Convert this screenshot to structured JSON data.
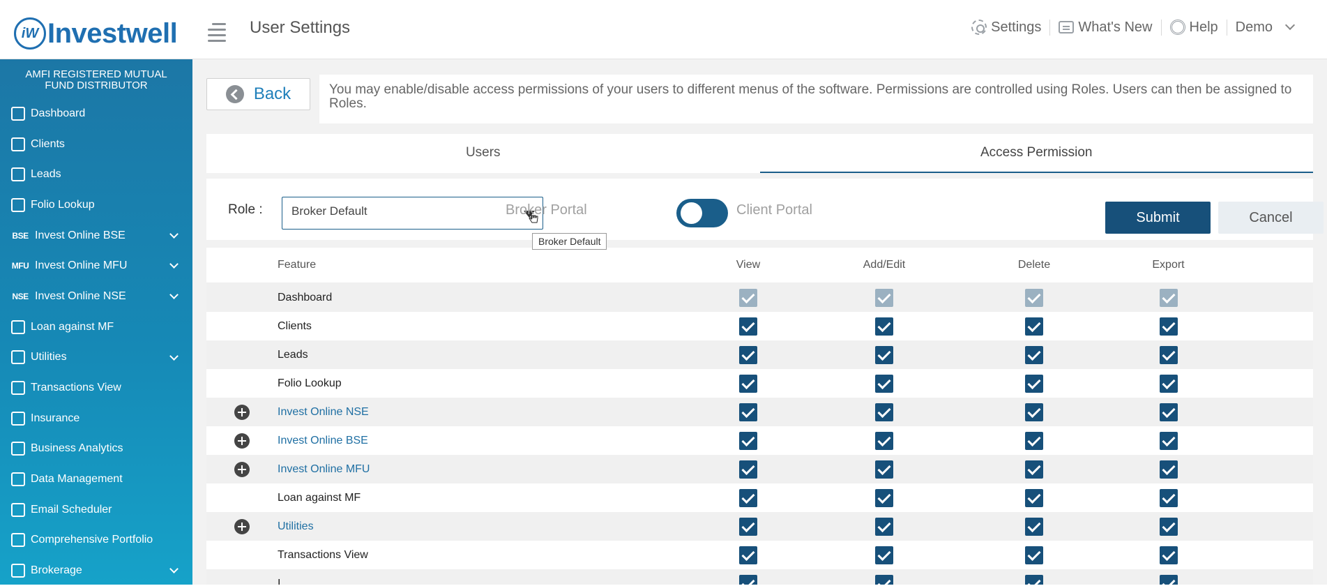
{
  "header": {
    "logo_text": "Investwell",
    "logo_mark": "iW",
    "page_title": "User Settings",
    "links": [
      {
        "label": "Settings",
        "icon": "gear-icon"
      },
      {
        "label": "What's New",
        "icon": "chat-icon"
      },
      {
        "label": "Help",
        "icon": "help-icon"
      },
      {
        "label": "Demo",
        "icon": "chevron-down-icon"
      }
    ]
  },
  "sidebar": {
    "heading": "AMFI REGISTERED MUTUAL FUND DISTRIBUTOR",
    "items": [
      {
        "label": "Dashboard",
        "icon": "home-icon",
        "badge": "",
        "expandable": false
      },
      {
        "label": "Clients",
        "icon": "users-icon",
        "badge": "",
        "expandable": false
      },
      {
        "label": "Leads",
        "icon": "leads-icon",
        "badge": "",
        "expandable": false
      },
      {
        "label": "Folio Lookup",
        "icon": "folio-icon",
        "badge": "",
        "expandable": false
      },
      {
        "label": "Invest Online BSE",
        "icon": "bse-icon",
        "badge": "BSE",
        "expandable": true
      },
      {
        "label": "Invest Online MFU",
        "icon": "mfu-icon",
        "badge": "MFU",
        "expandable": true
      },
      {
        "label": "Invest Online NSE",
        "icon": "nse-icon",
        "badge": "NSE",
        "expandable": true
      },
      {
        "label": "Loan against MF",
        "icon": "loan-icon",
        "badge": "",
        "expandable": false
      },
      {
        "label": "Utilities",
        "icon": "search-icon",
        "badge": "",
        "expandable": true
      },
      {
        "label": "Transactions View",
        "icon": "transfer-icon",
        "badge": "",
        "expandable": false
      },
      {
        "label": "Insurance",
        "icon": "insurance-icon",
        "badge": "",
        "expandable": false
      },
      {
        "label": "Business Analytics",
        "icon": "chart-icon",
        "badge": "",
        "expandable": false
      },
      {
        "label": "Data Management",
        "icon": "database-icon",
        "badge": "",
        "expandable": false
      },
      {
        "label": "Email Scheduler",
        "icon": "mail-icon",
        "badge": "",
        "expandable": false
      },
      {
        "label": "Comprehensive Portfolio",
        "icon": "briefcase-icon",
        "badge": "",
        "expandable": false
      },
      {
        "label": "Brokerage",
        "icon": "brokerage-icon",
        "badge": "",
        "expandable": true
      }
    ]
  },
  "main": {
    "back_label": "Back",
    "info_text": "You may enable/disable access permissions of your users to different menus of the software. Permissions are controlled using Roles. Users can then be assigned to Roles.",
    "tabs": [
      {
        "label": "Users",
        "active": false
      },
      {
        "label": "Access Permission",
        "active": true
      }
    ],
    "role_label": "Role :",
    "role_value": "Broker Default",
    "tooltip": "Broker Default",
    "portal_left": "Broker Portal",
    "portal_right": "Client Portal",
    "submit_label": "Submit",
    "cancel_label": "Cancel"
  },
  "permissions": {
    "columns": [
      "Feature",
      "View",
      "Add/Edit",
      "Delete",
      "Export"
    ],
    "rows": [
      {
        "feature": "Dashboard",
        "expandable": false,
        "disabled": true,
        "view": true,
        "add_edit": true,
        "delete": true,
        "export": true
      },
      {
        "feature": "Clients",
        "expandable": false,
        "disabled": false,
        "view": true,
        "add_edit": true,
        "delete": true,
        "export": true
      },
      {
        "feature": "Leads",
        "expandable": false,
        "disabled": false,
        "view": true,
        "add_edit": true,
        "delete": true,
        "export": true
      },
      {
        "feature": "Folio Lookup",
        "expandable": false,
        "disabled": false,
        "view": true,
        "add_edit": true,
        "delete": true,
        "export": true
      },
      {
        "feature": "Invest Online NSE",
        "expandable": true,
        "disabled": false,
        "view": true,
        "add_edit": true,
        "delete": true,
        "export": true
      },
      {
        "feature": "Invest Online BSE",
        "expandable": true,
        "disabled": false,
        "view": true,
        "add_edit": true,
        "delete": true,
        "export": true
      },
      {
        "feature": "Invest Online MFU",
        "expandable": true,
        "disabled": false,
        "view": true,
        "add_edit": true,
        "delete": true,
        "export": true
      },
      {
        "feature": "Loan against MF",
        "expandable": false,
        "disabled": false,
        "view": true,
        "add_edit": true,
        "delete": true,
        "export": true
      },
      {
        "feature": "Utilities",
        "expandable": true,
        "disabled": false,
        "view": true,
        "add_edit": true,
        "delete": true,
        "export": true
      },
      {
        "feature": "Transactions View",
        "expandable": false,
        "disabled": false,
        "view": true,
        "add_edit": true,
        "delete": true,
        "export": true
      },
      {
        "feature": "I...",
        "expandable": false,
        "disabled": false,
        "view": true,
        "add_edit": true,
        "delete": true,
        "export": true
      }
    ]
  },
  "colors": {
    "brand": "#1f6fb1",
    "primary": "#17507a",
    "sidebar_top": "#1c77a6",
    "sidebar_bottom": "#16a2c9",
    "link": "#1f6fa3"
  }
}
